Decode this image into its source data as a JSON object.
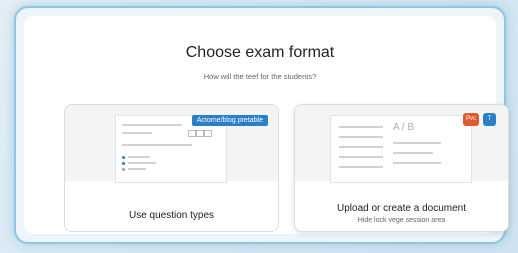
{
  "dialog": {
    "title": "Choose exam format",
    "subtitle": "How will the teef for the students?"
  },
  "options": [
    {
      "label": "Use question types",
      "badge": "Actome/blog pretable"
    },
    {
      "label": "Upload or create a document",
      "sublabel": "Hide lock vege session area",
      "doc_heading": "A / B",
      "chips": [
        "Pvc",
        "T"
      ]
    }
  ],
  "colors": {
    "accent": "#2b7fc7",
    "chip_pvc": "#e05a32",
    "chip_t": "#2b7fc7",
    "frame_border": "#8fc6e3"
  }
}
